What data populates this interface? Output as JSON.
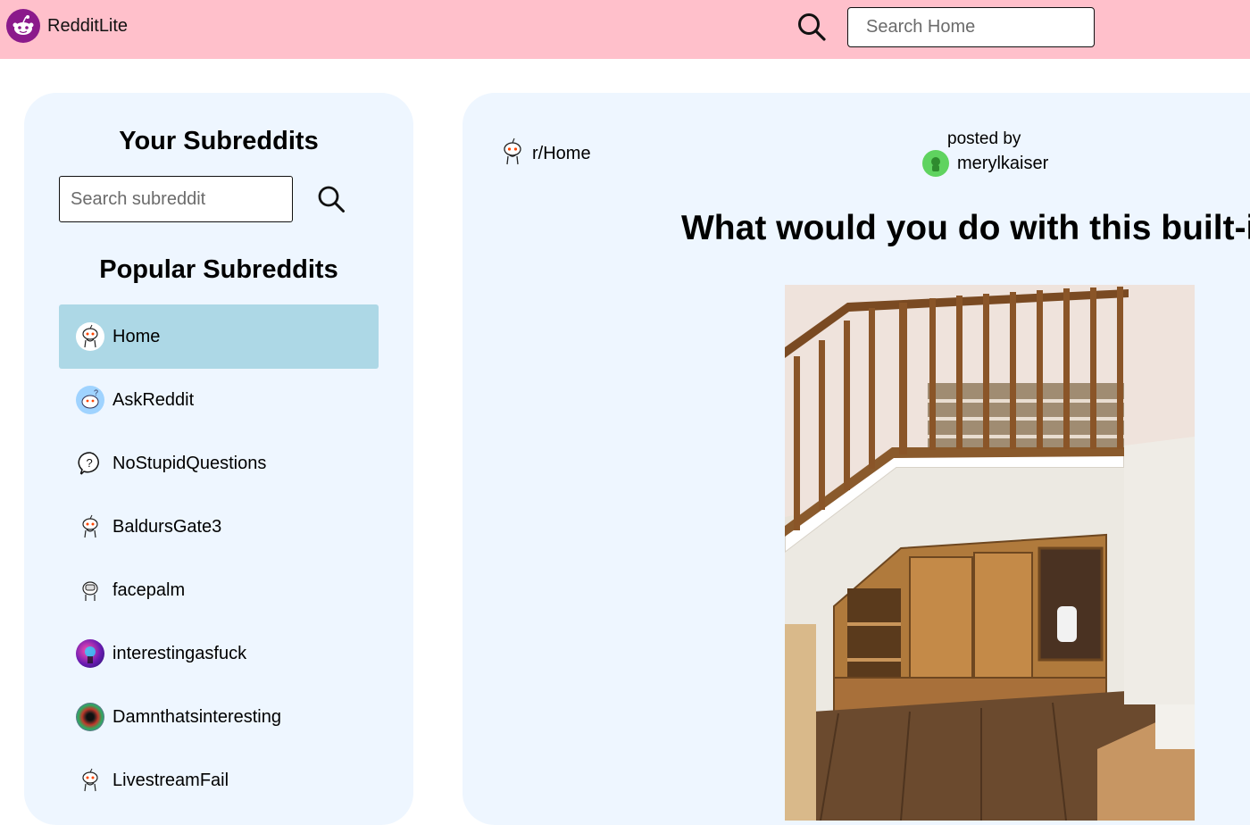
{
  "header": {
    "app_title": "RedditLite",
    "logo_icon": "reddit-alien-icon",
    "search_icon": "search-icon",
    "search_placeholder": "Search Home",
    "background": "#ffc0cb"
  },
  "sidebar": {
    "your_heading": "Your Subreddits",
    "search_placeholder": "Search subreddit",
    "popular_heading": "Popular Subreddits",
    "active_color": "#add8e6",
    "items": [
      {
        "label": "Home",
        "icon": "snoo-icon",
        "active": true
      },
      {
        "label": "AskReddit",
        "icon": "askreddit-icon",
        "active": false
      },
      {
        "label": "NoStupidQuestions",
        "icon": "question-bubble-icon",
        "active": false
      },
      {
        "label": "BaldursGate3",
        "icon": "snoo-icon",
        "active": false
      },
      {
        "label": "facepalm",
        "icon": "facepalm-icon",
        "active": false
      },
      {
        "label": "interestingasfuck",
        "icon": "interestingasfuck-icon",
        "active": false
      },
      {
        "label": "Damnthatsinteresting",
        "icon": "damnthatsinteresting-icon",
        "active": false
      },
      {
        "label": "LivestreamFail",
        "icon": "snoo-icon",
        "active": false
      }
    ]
  },
  "post": {
    "subreddit": "r/Home",
    "posted_by_label": "posted by",
    "author": "merylkaiser",
    "title": "What would you do with this built-in?",
    "image_icon": "post-photo-staircase-cabinet"
  }
}
